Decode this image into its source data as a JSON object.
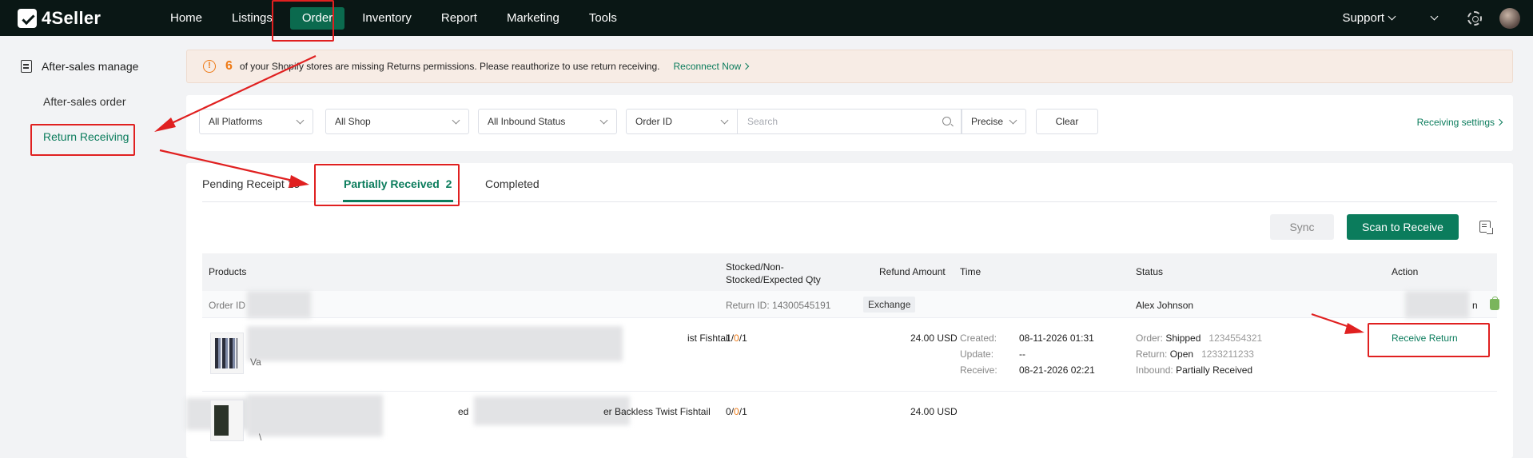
{
  "app": {
    "logo_text": "4Seller"
  },
  "topnav": {
    "items": [
      "Home",
      "Listings",
      "Order",
      "Inventory",
      "Report",
      "Marketing",
      "Tools"
    ],
    "active": "Order",
    "support_label": "Support"
  },
  "sidebar": {
    "section_title": "After-sales manage",
    "items": [
      "After-sales order",
      "Return Receiving"
    ],
    "active": "Return Receiving"
  },
  "banner": {
    "count": "6",
    "message": "of your Shopify stores are missing Returns permissions. Please reauthorize to use return receiving.",
    "link": "Reconnect Now"
  },
  "filters": {
    "platform": "All Platforms",
    "shop": "All Shop",
    "inbound_status": "All Inbound Status",
    "id_type": "Order ID",
    "search_placeholder": "Search",
    "match_mode": "Precise",
    "clear_label": "Clear",
    "settings_link": "Receiving settings"
  },
  "tabs": [
    {
      "label": "Pending Receipt",
      "count": "15"
    },
    {
      "label": "Partially Received",
      "count": "2"
    },
    {
      "label": "Completed",
      "count": ""
    }
  ],
  "toolbar": {
    "sync_label": "Sync",
    "scan_label": "Scan to Receive"
  },
  "table": {
    "headers": {
      "products": "Products",
      "qty_line1": "Stocked/Non-",
      "qty_line2": "Stocked/Expected Qty",
      "refund": "Refund Amount",
      "time": "Time",
      "status": "Status",
      "action": "Action"
    },
    "order": {
      "order_id_label": "Order ID",
      "return_id": "Return ID: 14300545191",
      "type_tag": "Exchange",
      "customer": "Alex Johnson",
      "shop_suffix": "n"
    },
    "rows": [
      {
        "product_title_fragment": "ist Fishtail",
        "product_sub_fragment": "Va",
        "stocked": "1",
        "non_stocked": "0",
        "expected": "1",
        "refund": "24.00 USD",
        "time_labels": [
          "Created:",
          "Update:",
          "Receive:"
        ],
        "time_values": [
          "08-11-2026 01:31",
          "--",
          "08-21-2026 02:21"
        ],
        "status_labels": [
          "Order:",
          "Return:",
          "Inbound:"
        ],
        "status_values": [
          "Shipped",
          "Open",
          "Partially Received"
        ],
        "status_ids": [
          "1234554321",
          "1233211233",
          ""
        ],
        "action": "Receive Return"
      },
      {
        "product_title_fragment": "ed",
        "product_title_fragment_2": "er Backless Twist Fishtail",
        "product_sub_fragment": "\\",
        "stocked": "0",
        "non_stocked": "0",
        "expected": "1",
        "refund": "24.00 USD"
      }
    ]
  },
  "colors": {
    "brand": "#0b7c5c",
    "warning": "#ee7a16",
    "annotation": "#e02020",
    "topbar": "#0a1715"
  }
}
